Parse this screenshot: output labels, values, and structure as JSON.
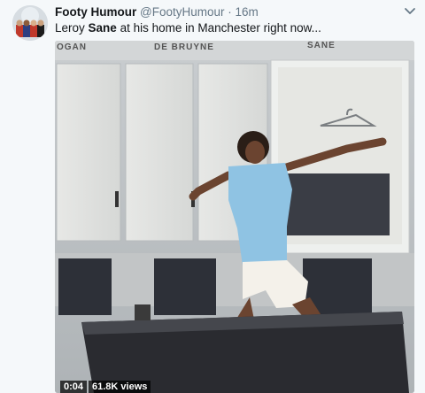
{
  "tweet": {
    "display_name": "Footy Humour",
    "handle": "@FootyHumour",
    "separator": "·",
    "time": "16m",
    "text_before": "Leroy ",
    "text_bold": "Sane",
    "text_after": " at his home in Manchester right now..."
  },
  "media": {
    "lockers": [
      "OGAN",
      "DE BRUYNE",
      "SANE"
    ],
    "duration": "0:04",
    "views": "61.8K views"
  },
  "icons": {
    "menu": "chevron-down-icon",
    "avatar": "avatar-image"
  }
}
